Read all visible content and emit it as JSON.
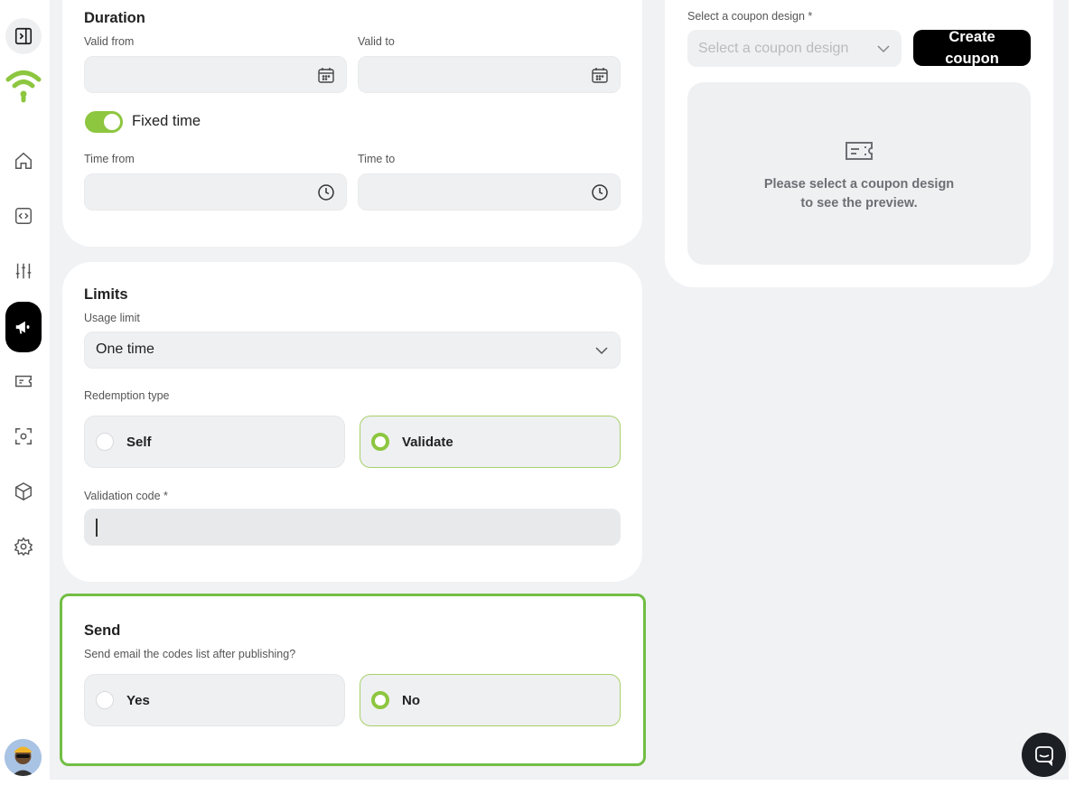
{
  "sidebar": {
    "items": [
      {
        "name": "home-icon"
      },
      {
        "name": "code-icon"
      },
      {
        "name": "sliders-icon"
      },
      {
        "name": "megaphone-icon"
      },
      {
        "name": "ticket-icon"
      },
      {
        "name": "scan-icon"
      },
      {
        "name": "box-icon"
      },
      {
        "name": "gear-icon"
      }
    ],
    "logo": "wifi-logo-icon",
    "brand_color": "#8dc63f"
  },
  "duration": {
    "title": "Duration",
    "valid_from_label": "Valid from",
    "valid_to_label": "Valid to",
    "fixed_time_label": "Fixed time",
    "fixed_time_on": true,
    "time_from_label": "Time from",
    "time_to_label": "Time to"
  },
  "limits": {
    "title": "Limits",
    "usage_limit_label": "Usage limit",
    "usage_limit_value": "One time",
    "redemption_type_label": "Redemption type",
    "options": [
      "Self",
      "Validate"
    ],
    "selected": "Validate",
    "validation_code_label": "Validation code *",
    "validation_code_value": ""
  },
  "send": {
    "title": "Send",
    "question": "Send email the codes list after publishing?",
    "options": [
      "Yes",
      "No"
    ],
    "selected": "No"
  },
  "coupon": {
    "design_label": "Select a coupon design *",
    "design_placeholder": "Select a coupon design",
    "create_button": "Create coupon",
    "preview_line1": "Please select a coupon design",
    "preview_line2": "to see the preview."
  },
  "colors": {
    "accent": "#8dc63f",
    "highlight_border": "#72be45",
    "canvas": "#f1f2f4"
  }
}
